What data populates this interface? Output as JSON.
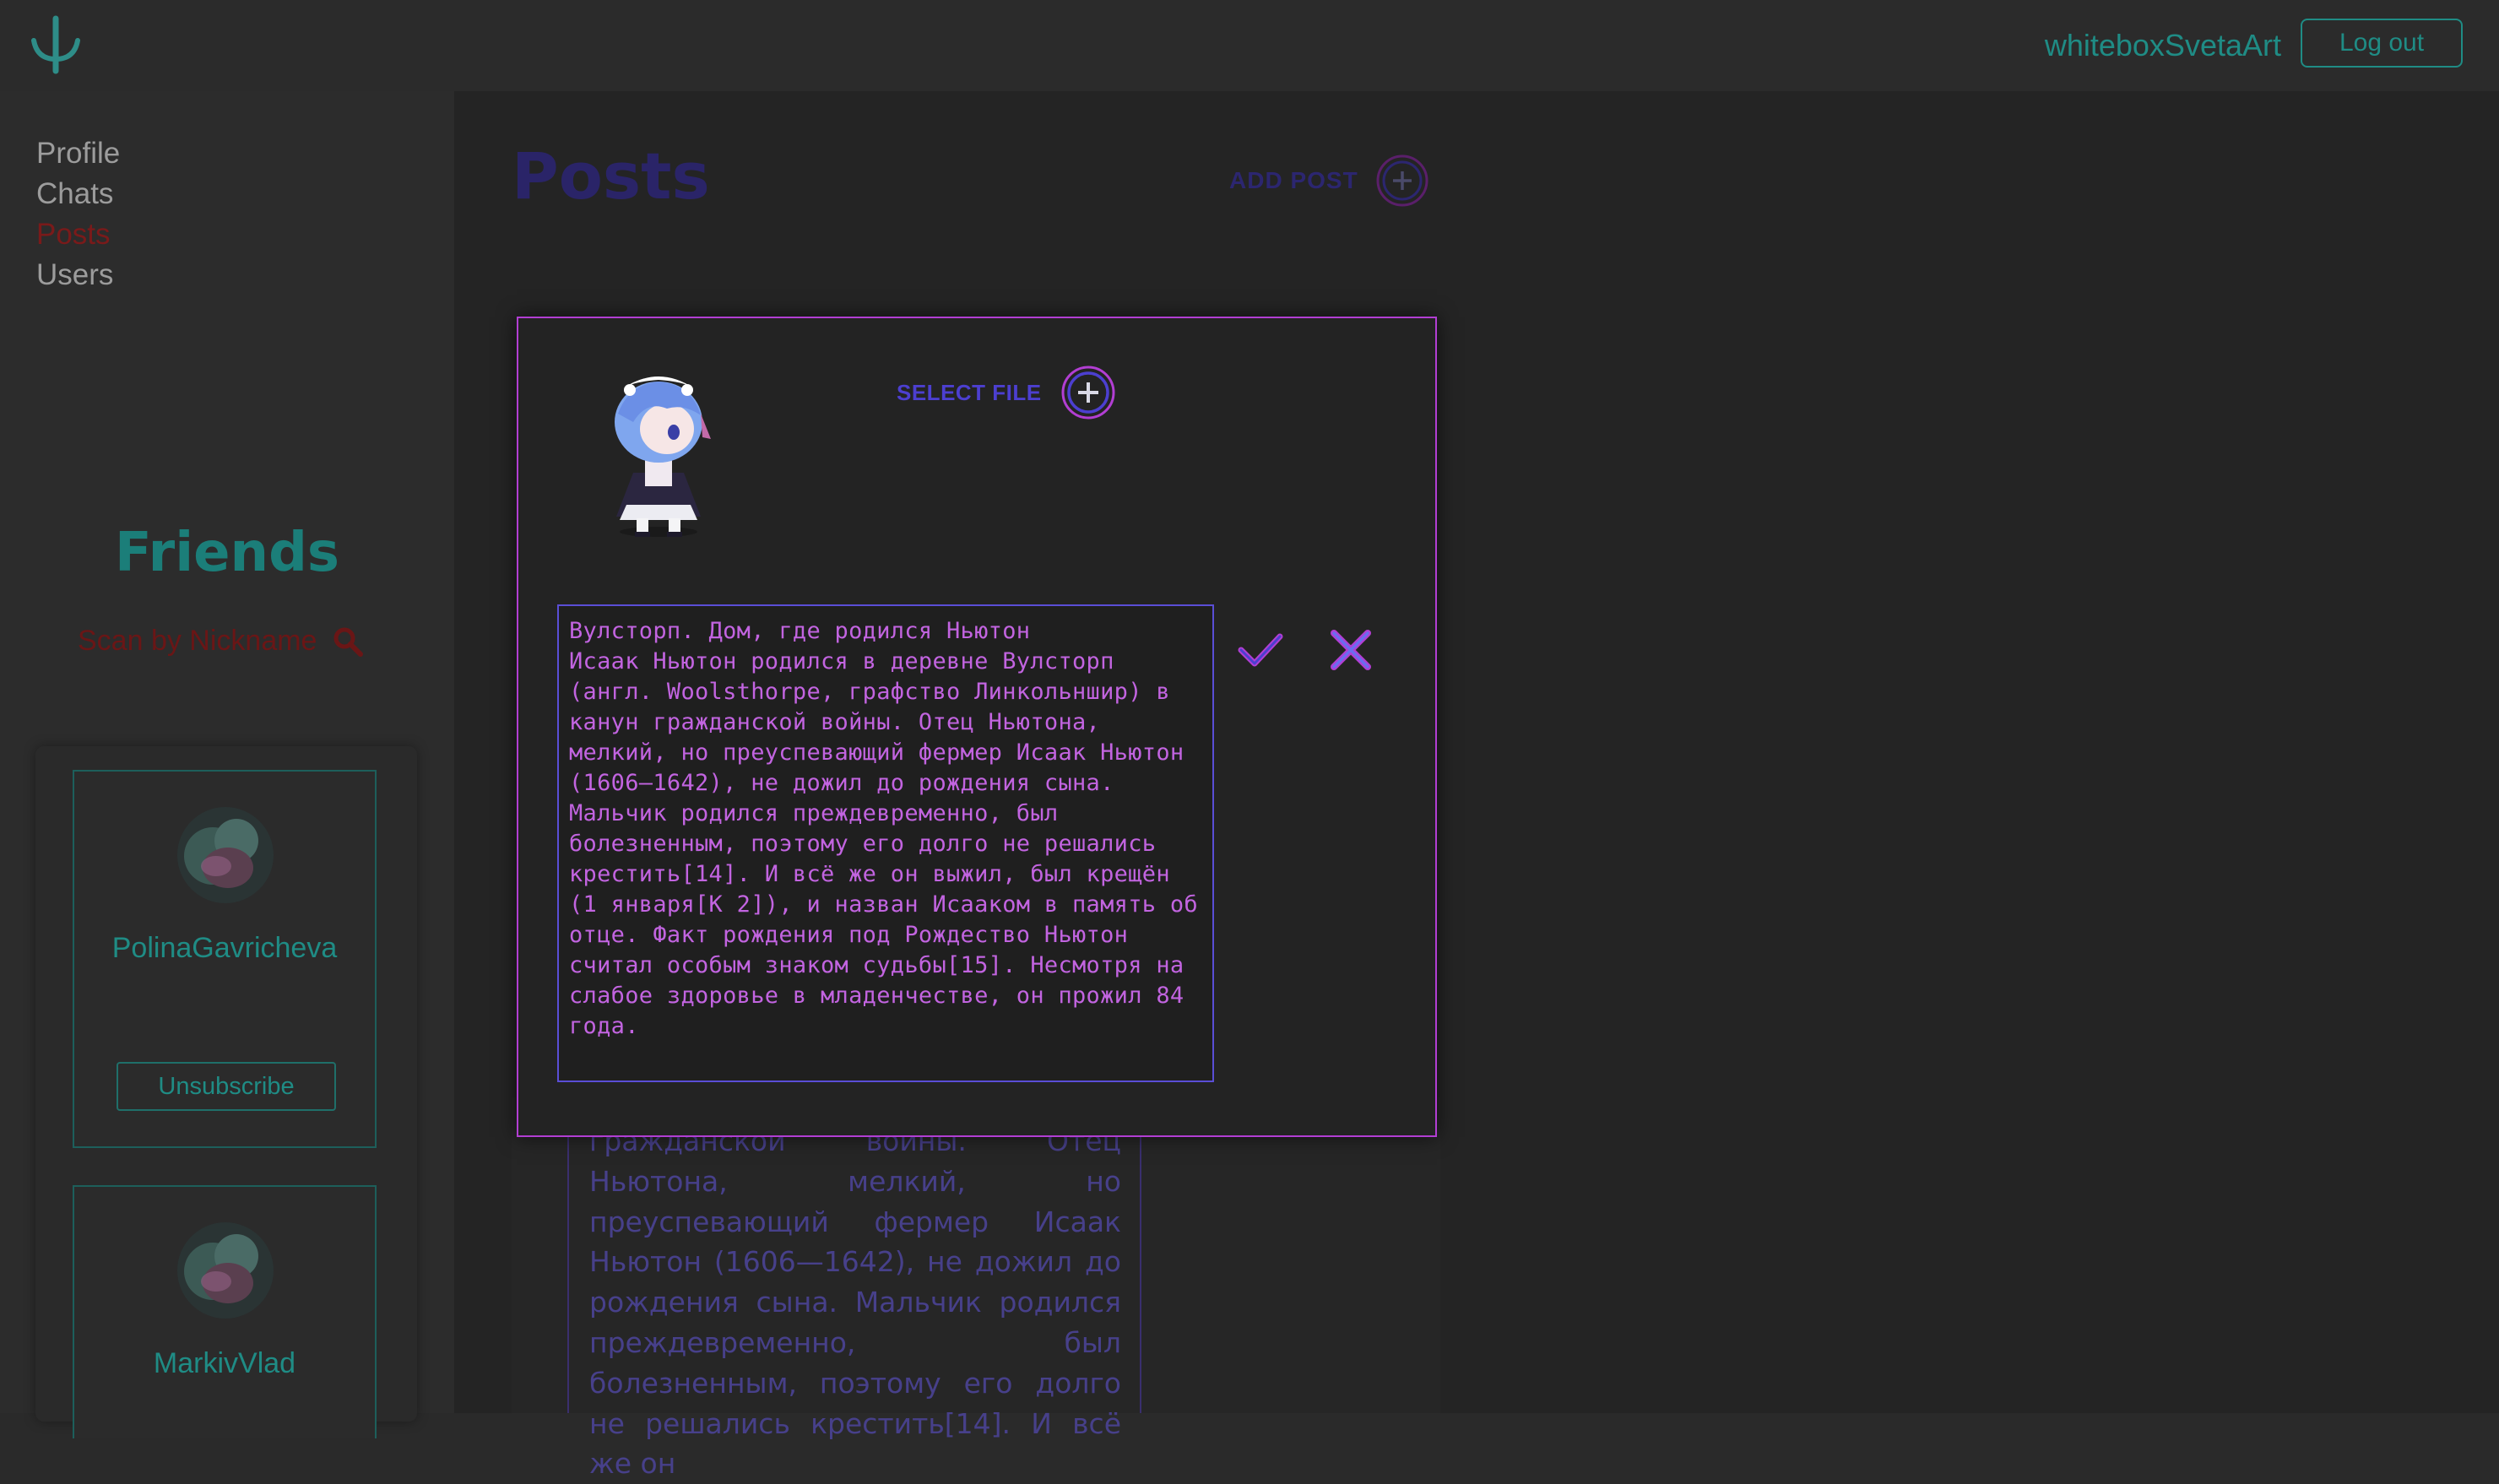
{
  "header": {
    "username": "whiteboxSvetaArt",
    "logout_label": "Log out"
  },
  "nav": {
    "items": [
      {
        "label": "Profile",
        "active": false
      },
      {
        "label": "Chats",
        "active": false
      },
      {
        "label": "Posts",
        "active": true
      },
      {
        "label": "Users",
        "active": false
      }
    ]
  },
  "friends": {
    "title": "Friends",
    "search_placeholder": "Scan by Nickname",
    "list": [
      {
        "name": "PolinaGavricheva",
        "action_label": "Unsubscribe"
      },
      {
        "name": "MarkivVlad"
      }
    ]
  },
  "posts": {
    "title": "Posts",
    "add_label": "ADD POST"
  },
  "modal": {
    "select_file_label": "SELECT FILE",
    "textarea_value": "Вулсторп. Дом, где родился Ньютон\nИсаак Ньютон родился в деревне Вулсторп (англ. Woolsthorpe, графство Линкольншир) в канун гражданской войны. Отец Ньютона, мелкий, но преуспевающий фермер Исаак Ньютон (1606—1642), не дожил до рождения сына. Мальчик родился преждевременно, был болезненным, поэтому его долго не решались крестить[14]. И всё же он выжил, был крещён (1 января[К 2]), и назван Исааком в память об отце. Факт рождения под Рождество Ньютон считал особым знаком судьбы[15]. Несмотря на слабое здоровье в младенчестве, он прожил 84 года.\n\n.."
  },
  "background_post": {
    "text": "гражданской войны. Отец Ньютона, мелкий, но преуспевающий фермер Исаак Ньютон (1606—1642), не дожил до рождения сына. Мальчик родился преждевременно, был болезненным, поэтому его долго не решались крестить[14]. И всё же он"
  },
  "colors": {
    "accent_teal": "#1f8c85",
    "active_nav": "#7a1a1a",
    "modal_border": "#b23ed3",
    "textarea_text": "#c264e0",
    "purple_accent": "#4c3fd0"
  }
}
